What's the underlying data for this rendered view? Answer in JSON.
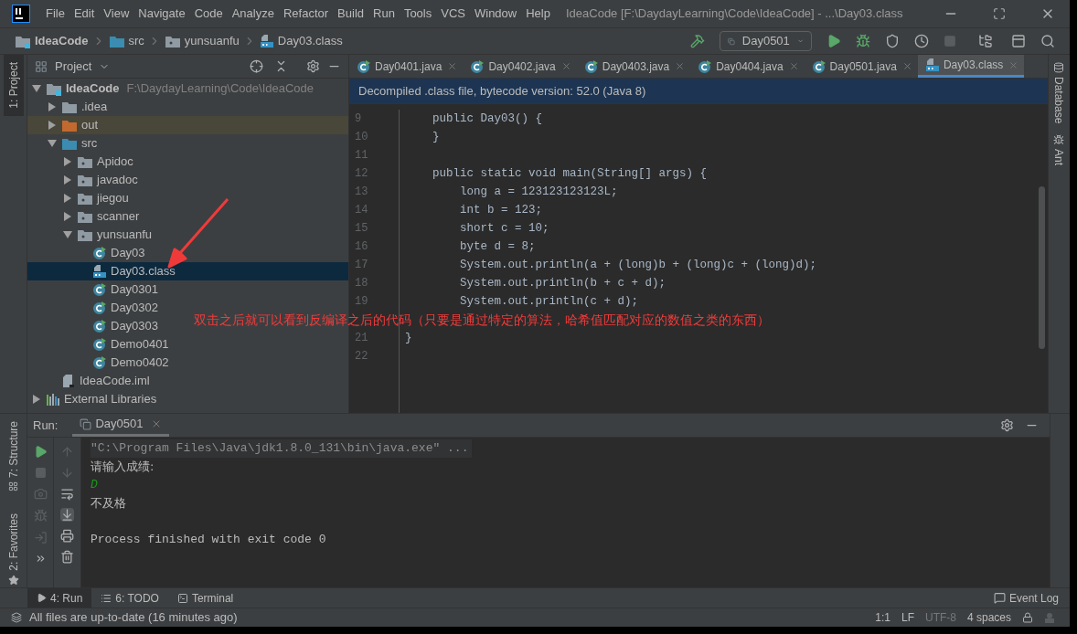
{
  "title_bar": {
    "menu": [
      "File",
      "Edit",
      "View",
      "Navigate",
      "Code",
      "Analyze",
      "Refactor",
      "Build",
      "Run",
      "Tools",
      "VCS",
      "Window",
      "Help"
    ],
    "title": "IdeaCode [F:\\DaydayLearning\\Code\\IdeaCode] - ...\\Day03.class"
  },
  "nav_bar": {
    "breadcrumbs": [
      {
        "label": "IdeaCode",
        "kind": "module"
      },
      {
        "label": "src",
        "kind": "source"
      },
      {
        "label": "yunsuanfu",
        "kind": "package"
      },
      {
        "label": "Day03.class",
        "kind": "classfile"
      }
    ],
    "run_config": "Day0501"
  },
  "left_stripe": [
    {
      "label": "1: Project",
      "selected": true,
      "kind": "top"
    },
    {
      "label": "7: Structure",
      "selected": false,
      "kind": "bottom"
    },
    {
      "label": "2: Favorites",
      "selected": false,
      "kind": "bottom"
    }
  ],
  "project_panel": {
    "title": "Project",
    "tree": [
      {
        "label": "IdeaCode",
        "path": "F:\\DaydayLearning\\Code\\IdeaCode",
        "kind": "module",
        "expanded": true,
        "selected": false,
        "children": [
          {
            "label": ".idea",
            "kind": "folder",
            "expanded": false,
            "selected": false
          },
          {
            "label": "out",
            "kind": "excluded",
            "expanded": false,
            "selected": false
          },
          {
            "label": "src",
            "kind": "source",
            "expanded": true,
            "selected": false,
            "children": [
              {
                "label": "Apidoc",
                "kind": "package",
                "expanded": false,
                "selected": false
              },
              {
                "label": "javadoc",
                "kind": "package",
                "expanded": false,
                "selected": false
              },
              {
                "label": "jiegou",
                "kind": "package",
                "expanded": false,
                "selected": false
              },
              {
                "label": "scanner",
                "kind": "package",
                "expanded": false,
                "selected": false
              },
              {
                "label": "yunsuanfu",
                "kind": "package",
                "expanded": true,
                "selected": false,
                "children": [
                  {
                    "label": "Day03",
                    "kind": "class",
                    "selected": false
                  },
                  {
                    "label": "Day03.class",
                    "kind": "classfile",
                    "selected": true
                  },
                  {
                    "label": "Day0301",
                    "kind": "class",
                    "selected": false
                  },
                  {
                    "label": "Day0302",
                    "kind": "class",
                    "selected": false
                  },
                  {
                    "label": "Day0303",
                    "kind": "class",
                    "selected": false
                  },
                  {
                    "label": "Demo0401",
                    "kind": "class",
                    "selected": false
                  },
                  {
                    "label": "Demo0402",
                    "kind": "class",
                    "selected": false
                  }
                ]
              }
            ]
          },
          {
            "label": "IdeaCode.iml",
            "kind": "iml",
            "selected": false
          }
        ]
      },
      {
        "label": "External Libraries",
        "kind": "libraries",
        "expanded": false,
        "selected": false
      }
    ]
  },
  "editor": {
    "tabs": [
      {
        "label": "Day0401.java",
        "kind": "class",
        "selected": false
      },
      {
        "label": "Day0402.java",
        "kind": "class",
        "selected": false
      },
      {
        "label": "Day0403.java",
        "kind": "class",
        "selected": false
      },
      {
        "label": "Day0404.java",
        "kind": "class",
        "selected": false
      },
      {
        "label": "Day0501.java",
        "kind": "class",
        "selected": false
      },
      {
        "label": "Day03.class",
        "kind": "classfile",
        "selected": true
      }
    ],
    "banner": "Decompiled .class file, bytecode version: 52.0 (Java 8)",
    "lines": [
      {
        "number": "9",
        "code": "    public Day03() {"
      },
      {
        "number": "10",
        "code": "    }"
      },
      {
        "number": "11"
      },
      {
        "number": "12",
        "code": "    public static void main(String[] args) {"
      },
      {
        "number": "13",
        "code": "        long a = 123123123123L;"
      },
      {
        "number": "14",
        "code": "        int b = 123;"
      },
      {
        "number": "15",
        "code": "        short c = 10;"
      },
      {
        "number": "16",
        "code": "        byte d = 8;"
      },
      {
        "number": "17",
        "code": "        System.out.println(a + (long)b + (long)c + (long)d);"
      },
      {
        "number": "18",
        "code": "        System.out.println(b + c + d);"
      },
      {
        "number": "19",
        "code": "        System.out.println(c + d);"
      },
      {
        "covered_by_annotation": true
      },
      {
        "number": "21",
        "code": "}"
      },
      {
        "number": "22"
      }
    ]
  },
  "right_stripe": [
    {
      "label": "Database",
      "kind": "database"
    },
    {
      "label": "Ant",
      "kind": "ant"
    }
  ],
  "annotation": "双击之后就可以看到反编译之后的代码（只要是通过特定的算法，哈希值匹配对应的数值之类的东西）",
  "run_panel": {
    "label": "Run:",
    "tab": "Day0501",
    "output": [
      {
        "kind": "command",
        "text": "\"C:\\Program Files\\Java\\jdk1.8.0_131\\bin\\java.exe\" ..."
      },
      {
        "kind": "plain",
        "text": "请输入成绩:"
      },
      {
        "kind": "input",
        "text": "D"
      },
      {
        "kind": "plain",
        "text": "不及格"
      },
      {
        "kind": "exit",
        "text": "Process finished with exit code 0"
      }
    ]
  },
  "bottom_tabs": [
    {
      "label": "4: Run",
      "kind": "run",
      "selected": true
    },
    {
      "label": "6: TODO",
      "kind": "todo",
      "selected": false
    },
    {
      "label": "Terminal",
      "kind": "terminal",
      "selected": false
    }
  ],
  "event_log": "Event Log",
  "status_bar": {
    "message": "All files are up-to-date (16 minutes ago)",
    "items": [
      {
        "label": "1:1",
        "disabled": false
      },
      {
        "label": "LF",
        "disabled": false
      },
      {
        "label": "UTF-8",
        "disabled": true
      },
      {
        "label": "4 spaces",
        "disabled": false
      }
    ]
  }
}
